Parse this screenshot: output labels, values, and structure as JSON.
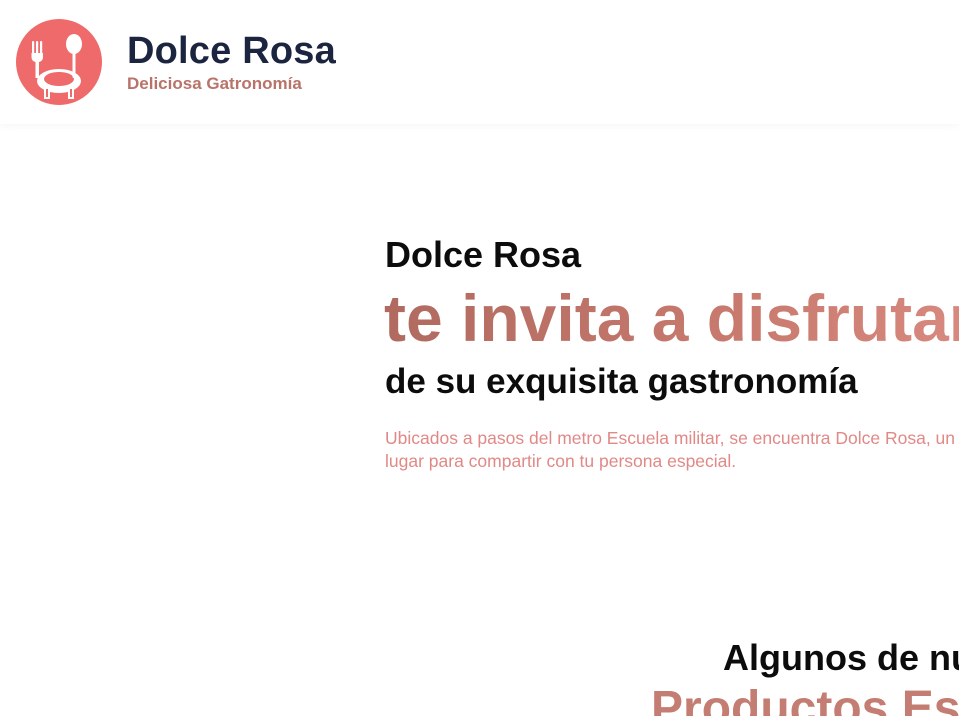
{
  "header": {
    "logo_icon": "fork-spoon-plate-icon",
    "brand_title": "Dolce Rosa",
    "brand_subtitle": "Deliciosa Gatronomía"
  },
  "hero": {
    "kicker": "Dolce Rosa",
    "headline": "te invita a disfrutar",
    "subheadline": "de su exquisita gastronomía",
    "description": "Ubicados a pasos del metro Escuela militar, se encuentra Dolce Rosa, un lugar para compartir con tu persona especial."
  },
  "products": {
    "kicker": "Algunos de nuestros",
    "title": "Productos Especiales"
  },
  "colors": {
    "logo_background": "#ef6a6a",
    "brand_title": "#1c2540",
    "accent": "#c47068",
    "description": "#e08986"
  }
}
